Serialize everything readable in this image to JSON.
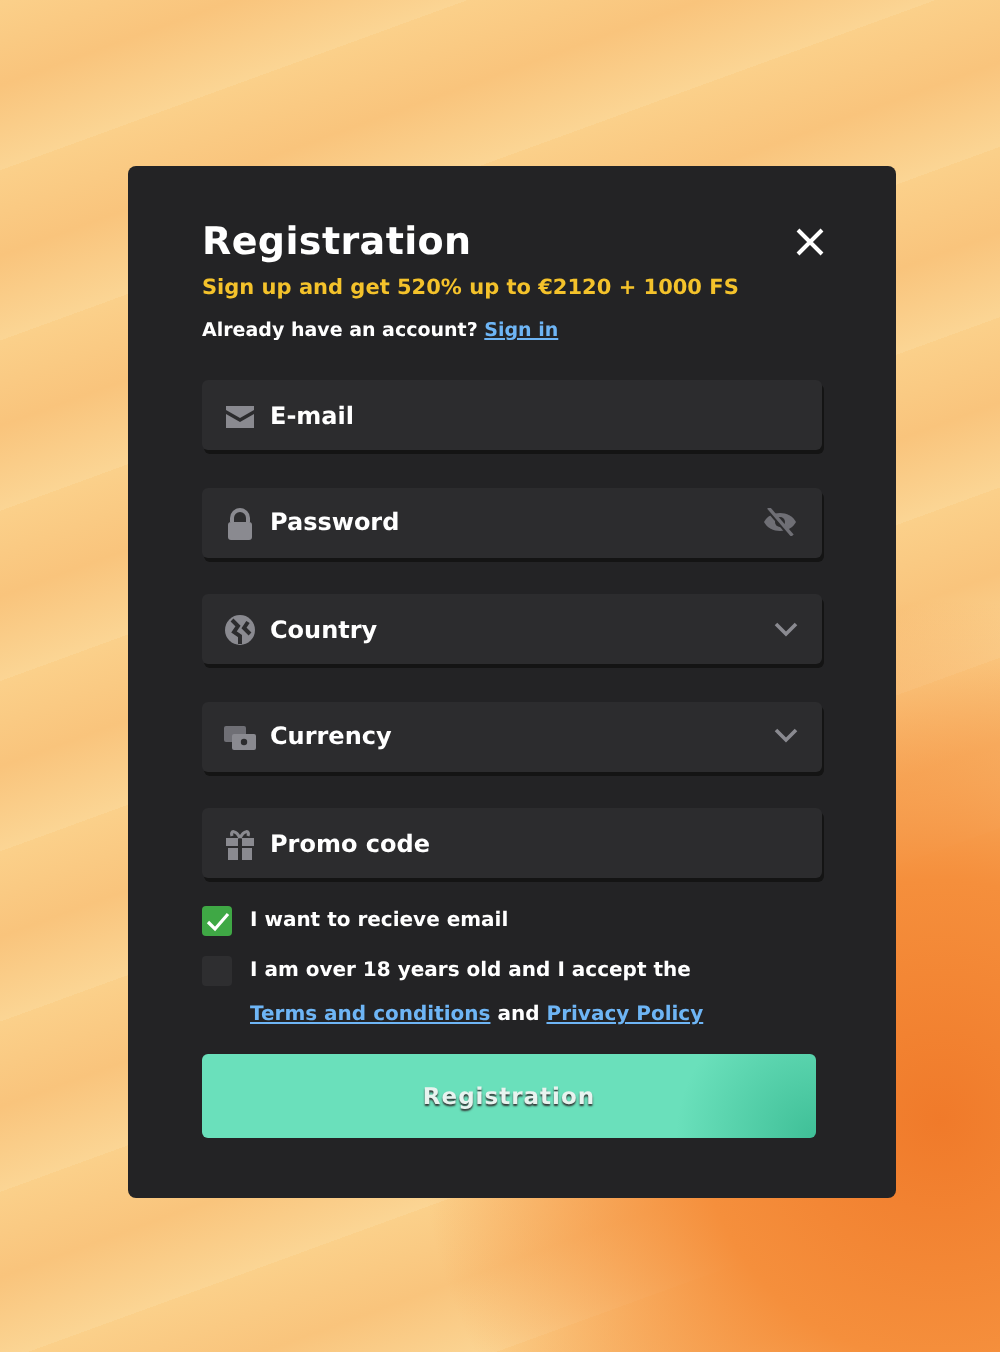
{
  "dialog": {
    "title": "Registration",
    "promo": "Sign up and get 520% up to €2120 + 1000 FS",
    "account_prompt": "Already have an account?",
    "sign_in_link": "Sign in"
  },
  "fields": [
    {
      "kind": "text",
      "placeholder": "E-mail"
    },
    {
      "kind": "password",
      "placeholder": "Password"
    },
    {
      "kind": "select",
      "placeholder": "Country"
    },
    {
      "kind": "select",
      "placeholder": "Currency"
    },
    {
      "kind": "text",
      "placeholder": "Promo code"
    }
  ],
  "checkboxes": [
    {
      "checked": true,
      "segments": [
        {
          "kind": "text",
          "text": "I want to recieve email"
        }
      ]
    },
    {
      "checked": false,
      "segments": [
        {
          "kind": "text",
          "text": "I am over 18 years old and I accept the"
        },
        {
          "kind": "link",
          "text": "Terms and conditions"
        },
        {
          "kind": "text",
          "text": "and"
        },
        {
          "kind": "link",
          "text": "Privacy Policy"
        }
      ]
    }
  ],
  "submit_button": "Registration"
}
